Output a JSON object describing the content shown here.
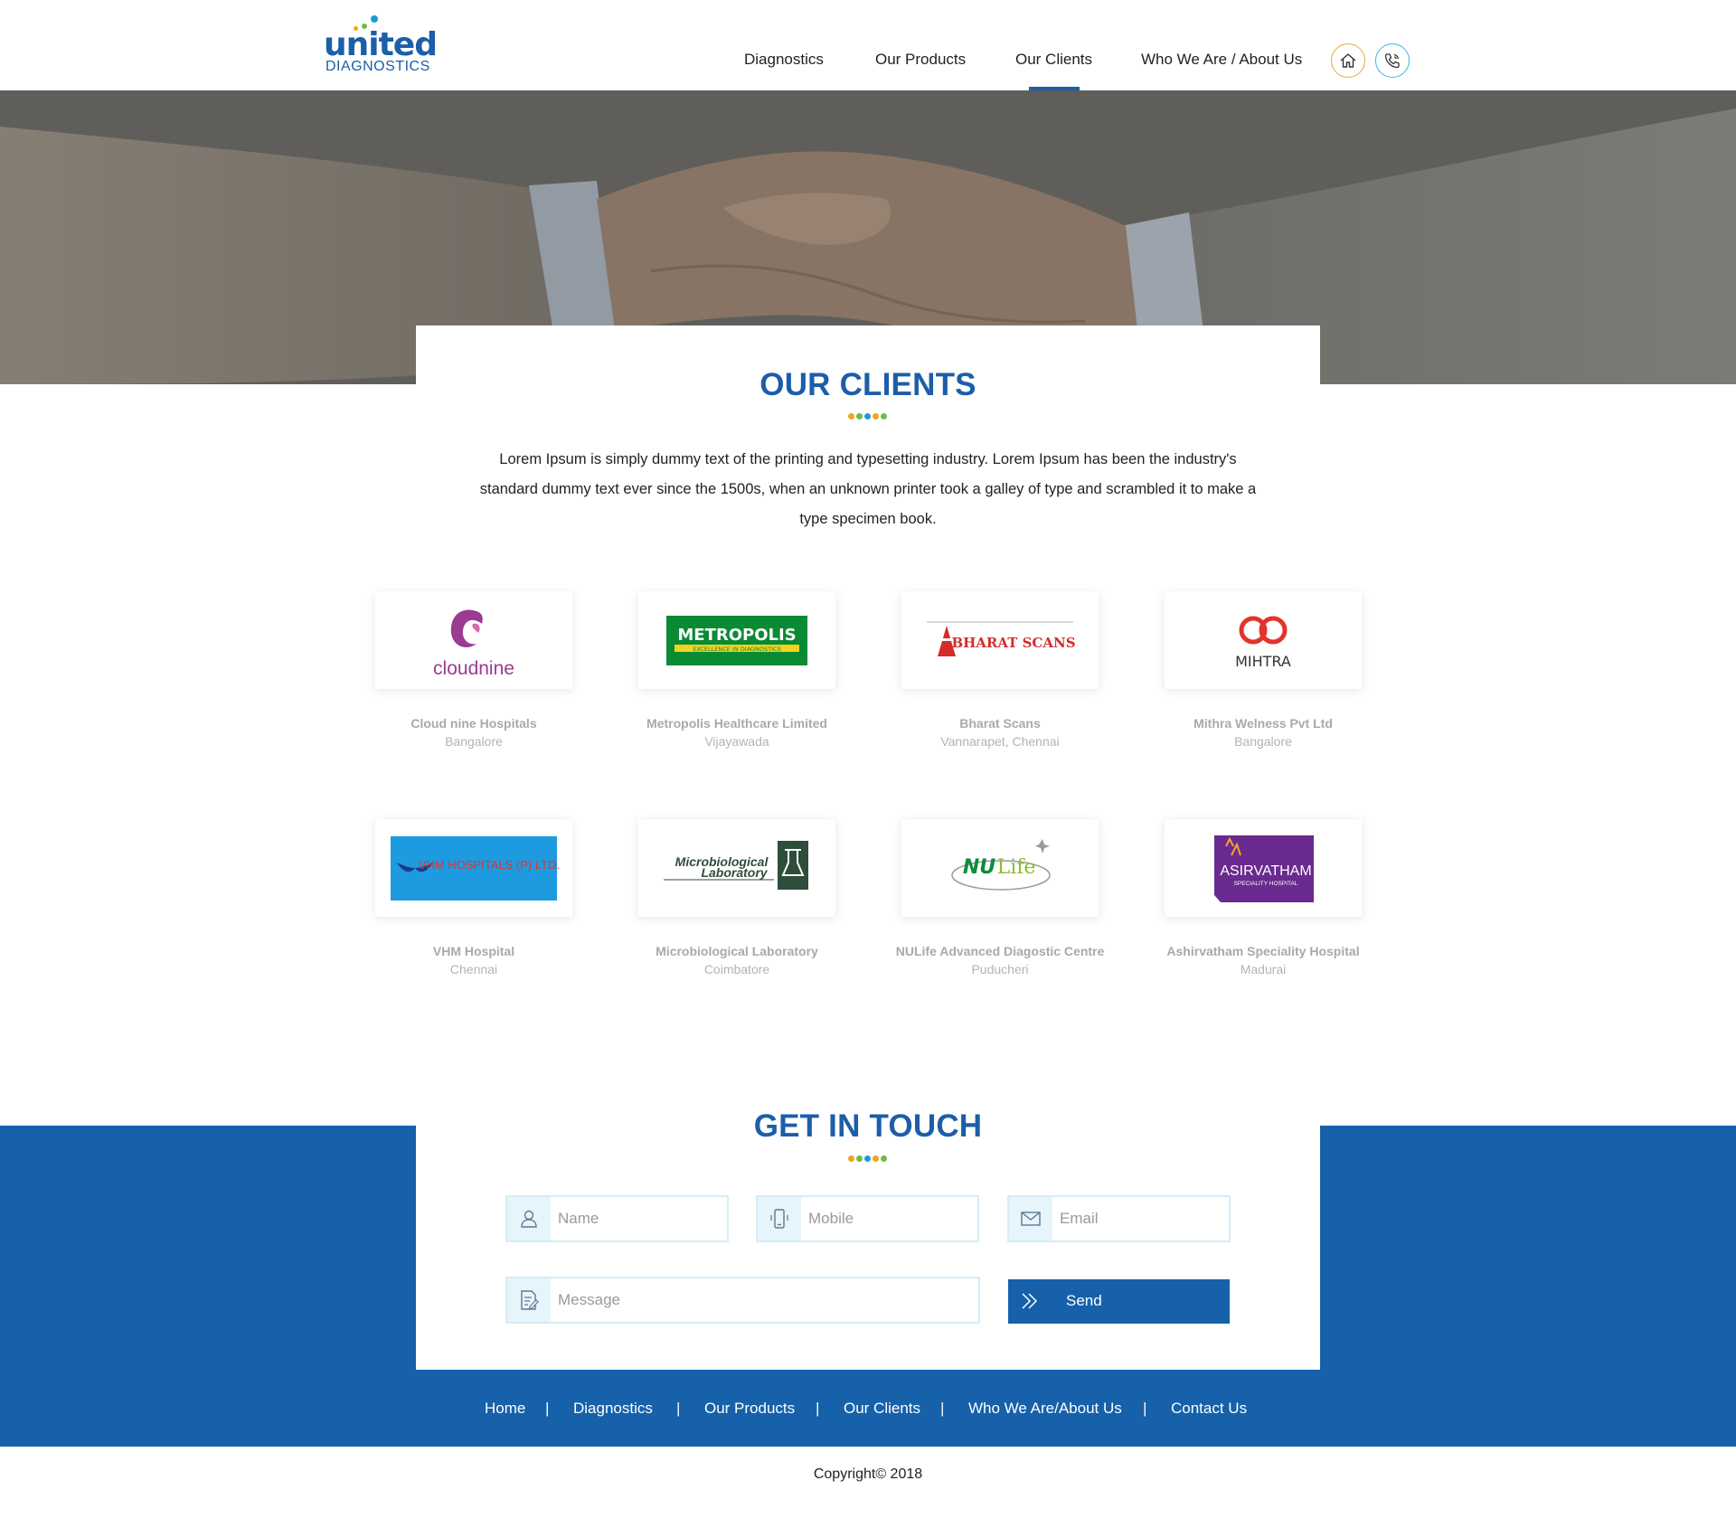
{
  "brand": {
    "name": "united",
    "tagline": "DIAGNOSTICS",
    "primary_color": "#1c5ea8"
  },
  "nav": {
    "items": [
      {
        "label": "Diagnostics"
      },
      {
        "label": "Our Products"
      },
      {
        "label": "Our Clients",
        "active": true
      },
      {
        "label": "Who We Are / About Us"
      }
    ],
    "home_icon": "home-icon",
    "phone_icon": "phone-icon"
  },
  "hero": {
    "image": "handshake-photo"
  },
  "clients": {
    "title": "OUR CLIENTS",
    "intro": "Lorem Ipsum is simply dummy text of the printing and typesetting industry. Lorem Ipsum has been the industry's standard dummy text ever since the 1500s, when an unknown printer took a galley of type and scrambled it to make a type specimen book.",
    "items": [
      {
        "name": "Cloud nine Hospitals",
        "city": "Bangalore",
        "logo_text": "cloudnine"
      },
      {
        "name": "Metropolis Healthcare Limited",
        "city": "Vijayawada",
        "logo_text": "METROPOLIS",
        "logo_sub": "EXCELLENCE IN DIAGNOSTICS"
      },
      {
        "name": "Bharat Scans",
        "city": "Vannarapet, Chennai",
        "logo_text": "BHARAT SCANS"
      },
      {
        "name": "Mithra Welness Pvt Ltd",
        "city": "Bangalore",
        "logo_text": "MIHTRA"
      },
      {
        "name": "VHM Hospital",
        "city": "Chennai",
        "logo_text": "VHM HOSPITALS (P) LTD."
      },
      {
        "name": "Microbiological Laboratory",
        "city": "Coimbatore",
        "logo_text": "Microbiological",
        "logo_text2": "Laboratory"
      },
      {
        "name": "NULife Advanced Diagostic Centre",
        "city": "Puducheri",
        "logo_text": "NU",
        "logo_text2": "Life"
      },
      {
        "name": "Ashirvatham Speciality Hospital",
        "city": "Madurai",
        "logo_text": "ASIRVATHAM",
        "logo_sub": "SPECIALITY HOSPITAL"
      }
    ]
  },
  "contact": {
    "title": "GET IN TOUCH",
    "name_placeholder": "Name",
    "mobile_placeholder": "Mobile",
    "email_placeholder": "Email",
    "message_placeholder": "Message",
    "send_label": "Send"
  },
  "footer": {
    "links": [
      "Home",
      "Diagnostics",
      "Our Products",
      "Our Clients",
      "Who We Are/About Us",
      "Contact Us"
    ],
    "copyright": "Copyright© 2018"
  }
}
